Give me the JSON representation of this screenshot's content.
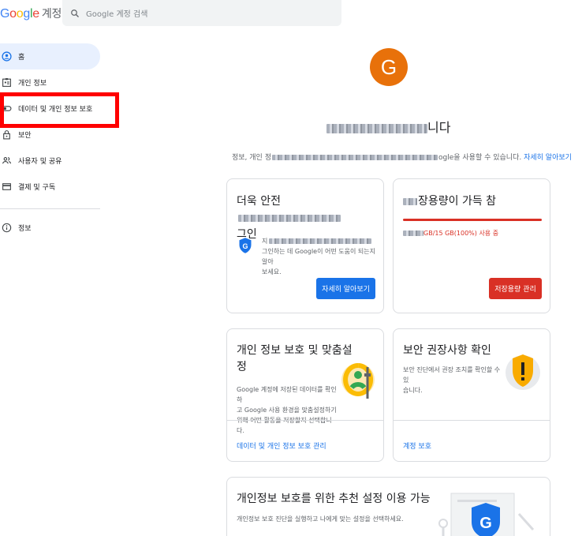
{
  "header": {
    "logo_text": "Google",
    "logo_suffix": "계정",
    "search_placeholder": "Google 계정 검색"
  },
  "sidebar": {
    "items": [
      {
        "label": "홈",
        "icon": "home-person-icon",
        "active": true
      },
      {
        "label": "개인 정보",
        "icon": "id-card-icon"
      },
      {
        "label": "데이터 및 개인 정보 보호",
        "icon": "toggle-icon"
      },
      {
        "label": "보안",
        "icon": "lock-icon"
      },
      {
        "label": "사용자 및 공유",
        "icon": "people-icon"
      },
      {
        "label": "결제 및 구독",
        "icon": "card-icon"
      },
      {
        "label": "정보",
        "icon": "info-icon"
      }
    ]
  },
  "profile": {
    "avatar_letter": "G",
    "greeting_suffix": "니다",
    "desc_prefix": "정보, 개인 정",
    "desc_suffix": "ogle을 사용할 수 있습니다.",
    "desc_link": "자세히 알아보기"
  },
  "cards": {
    "security": {
      "title_line1": "더욱 안전",
      "title_line2": "그인",
      "text_prefix": "지",
      "text_line2": "그인하는 데 Google이 어떤 도움이 되는지 알아",
      "text_line3": "보세요.",
      "button": "자세히 알아보기"
    },
    "storage": {
      "title": "장용량이 가득 참",
      "usage": "GB/15 GB(100%) 사용 중",
      "usage_percent": 100,
      "button": "저장용량 관리"
    },
    "privacy": {
      "title_line1": "개인 정보 보호 및 맞춤설",
      "title_line2": "정",
      "text_line1": "Google 계정에 저장된 데이터를 확인하",
      "text_line2": "고 Google 사용 환경을 맞춤설정하기",
      "text_line3": "위해 어떤 활동을 저장할지 선택합니다.",
      "link": "데이터 및 개인 정보 보호 관리"
    },
    "security_check": {
      "title": "보안 권장사항 확인",
      "text_line1": "보안 진단에서 권장 조치를 확인할 수 있",
      "text_line2": "습니다.",
      "link": "계정 보호"
    },
    "privacy_recommend": {
      "title": "개인정보 보호를 위한 추천 설정 이용 가능",
      "text": "개인정보 보호 진단을 실행하고 나에게 맞는 설정을 선택하세요."
    }
  },
  "colors": {
    "accent": "#1a73e8",
    "danger": "#d93025",
    "avatar": "#e8710a",
    "highlight": "#ff0000"
  }
}
